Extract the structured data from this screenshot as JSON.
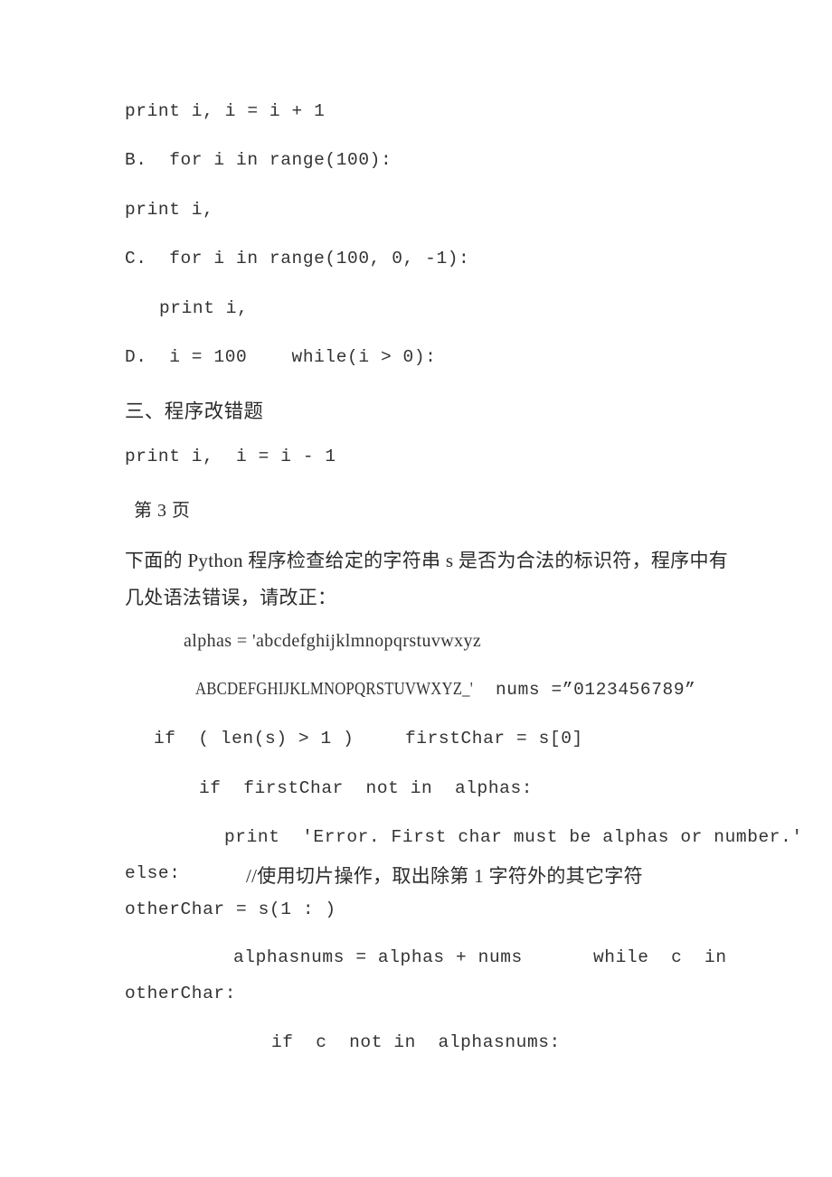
{
  "document": {
    "page_label": "第 3 页",
    "background_color": "#ffffff",
    "text_color": "#2b2b2b"
  },
  "lines": {
    "choice_a_body": "print i, i = i + 1",
    "choice_b_head": "B.  for i in range(100):",
    "choice_b_body": "print i,",
    "choice_c_head": "C.  for i in range(100, 0, -1):",
    "choice_c_body": "print i,",
    "choice_d_head": "D.  i = 100    while(i > 0):",
    "section_heading": "三、程序改错题",
    "choice_d_body": "print i,  i = i - 1"
  },
  "prompt": {
    "text_line1": "下面的 Python 程序检查给定的字符串 s 是否为合法的标识符，程序中有",
    "text_line2": "几处语法错误，请改正："
  },
  "code_block": {
    "alphas_lower": "alphas = 'abcdefghijklmnopqrstuvwxyz",
    "alphas_upper": "ABCDEFGHIJKLMNOPQRSTUVWXYZ_'",
    "nums_assign": "nums =”0123456789”",
    "if_len": "if  ( len(s) > 1 )",
    "first_char": "firstChar = s[0]",
    "if_first_char": "if  firstChar  not in  alphas:",
    "print_error": "print  'Error. First char must be alphas or number.'",
    "else_keyword": "else:",
    "slice_comment": "//使用切片操作，取出除第 1 字符外的其它字符",
    "other_char_assign": "otherChar = s(1 : )",
    "alphasnums_assign": "alphasnums = alphas + nums",
    "while_head": "while  c  in",
    "while_tail": "otherChar:",
    "if_not_in": "if  c  not in  alphasnums:"
  }
}
